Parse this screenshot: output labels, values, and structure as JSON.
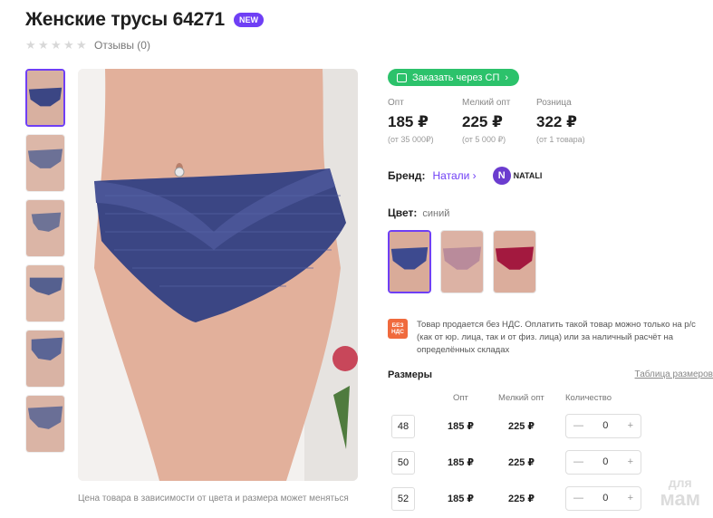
{
  "product": {
    "title": "Женские трусы 64271",
    "badge": "NEW",
    "reviews": "Отзывы (0)",
    "rating_stars": 0
  },
  "gallery": {
    "caption": "Цена товара в зависимости от цвета и размера может меняться"
  },
  "order": {
    "sp_button": "Заказать через СП"
  },
  "prices": [
    {
      "label": "Опт",
      "value": "185 ₽",
      "note": "(от 35 000₽)"
    },
    {
      "label": "Мелкий опт",
      "value": "225 ₽",
      "note": "(от 5 000 ₽)"
    },
    {
      "label": "Розница",
      "value": "322 ₽",
      "note": "(от 1 товара)"
    }
  ],
  "brand": {
    "label": "Бренд:",
    "name": "Натали",
    "logo_letter": "N",
    "logo_text": "NATALI"
  },
  "color": {
    "label": "Цвет:",
    "value": "синий",
    "options": [
      "#3d4a8f",
      "#b98b9b",
      "#a3193f"
    ]
  },
  "vat": {
    "icon_text": "БЕЗ НДС",
    "text": "Товар продается без НДС. Оплатить такой товар можно только на р/с (как от юр. лица, так и от физ. лица) или за наличный расчёт на определённых складах"
  },
  "sizes": {
    "title": "Размеры",
    "table_link": "Таблица размеров",
    "headers": {
      "opt": "Опт",
      "small": "Мелкий опт",
      "qty": "Количество"
    },
    "rows": [
      {
        "size": "48",
        "opt": "185 ₽",
        "small": "225 ₽",
        "qty": "0"
      },
      {
        "size": "50",
        "opt": "185 ₽",
        "small": "225 ₽",
        "qty": "0"
      },
      {
        "size": "52",
        "opt": "185 ₽",
        "small": "225 ₽",
        "qty": "0"
      }
    ]
  },
  "watermark": {
    "line1": "для",
    "line2": "мам"
  },
  "colors": {
    "accent": "#6f3ff5",
    "green": "#2cc26b",
    "vat_orange": "#f06a3d"
  }
}
